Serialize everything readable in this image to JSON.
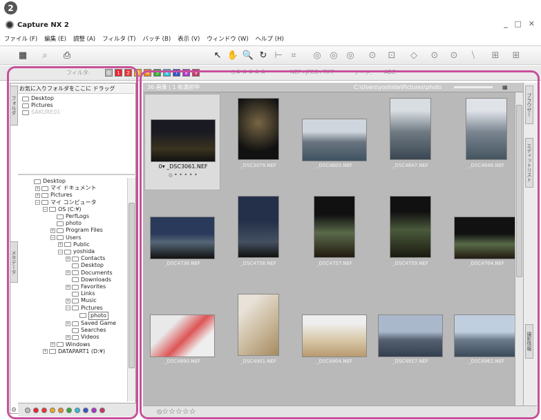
{
  "badge": "2",
  "app": {
    "title": "Capture NX 2",
    "window_controls": "_ □ ✕"
  },
  "menu": [
    "ファイル (F)",
    "編集 (E)",
    "調整 (A)",
    "フィルタ (T)",
    "バッチ (B)",
    "表示 (V)",
    "ウィンドウ (W)",
    "ヘルプ (H)"
  ],
  "toolbar2": {
    "filter_label": "フィルタ:",
    "label_nums": [
      "0",
      "1",
      "2",
      "3",
      "4",
      "5",
      "6",
      "7",
      "8",
      "9"
    ],
    "stars": "⦸★★★★★",
    "filetype": "NEF+JPEG+TIFF",
    "sort": "ソート:",
    "sort_val": "ABC"
  },
  "favorites": {
    "header": "お気に入りフォルダをここに ドラッグ",
    "items": [
      "Desktop",
      "Pictures",
      "SAKURE01"
    ]
  },
  "tree": [
    {
      "label": "Desktop",
      "depth": 0,
      "exp": ""
    },
    {
      "label": "マイ ドキュメント",
      "depth": 1,
      "exp": "+"
    },
    {
      "label": "Pictures",
      "depth": 1,
      "exp": "+"
    },
    {
      "label": "マイ コンピュータ",
      "depth": 1,
      "exp": "−"
    },
    {
      "label": "OS (C:¥)",
      "depth": 2,
      "exp": "−"
    },
    {
      "label": "PerfLogs",
      "depth": 3,
      "exp": ""
    },
    {
      "label": "photo",
      "depth": 3,
      "exp": ""
    },
    {
      "label": "Program Files",
      "depth": 3,
      "exp": "+"
    },
    {
      "label": "Users",
      "depth": 3,
      "exp": "−"
    },
    {
      "label": "Public",
      "depth": 4,
      "exp": "+"
    },
    {
      "label": "yoshida",
      "depth": 4,
      "exp": "−"
    },
    {
      "label": "Contacts",
      "depth": 5,
      "exp": "+"
    },
    {
      "label": "Desktop",
      "depth": 5,
      "exp": ""
    },
    {
      "label": "Documents",
      "depth": 5,
      "exp": "+"
    },
    {
      "label": "Downloads",
      "depth": 5,
      "exp": ""
    },
    {
      "label": "Favorites",
      "depth": 5,
      "exp": "+"
    },
    {
      "label": "Links",
      "depth": 5,
      "exp": ""
    },
    {
      "label": "Music",
      "depth": 5,
      "exp": "+"
    },
    {
      "label": "Pictures",
      "depth": 5,
      "exp": "−"
    },
    {
      "label": "photo",
      "depth": 6,
      "exp": "",
      "selected": true
    },
    {
      "label": "Saved Game",
      "depth": 5,
      "exp": "+"
    },
    {
      "label": "Searches",
      "depth": 5,
      "exp": ""
    },
    {
      "label": "Videos",
      "depth": 5,
      "exp": "+"
    },
    {
      "label": "Windows",
      "depth": 3,
      "exp": "+"
    },
    {
      "label": "DATAPART1 (D:¥)",
      "depth": 2,
      "exp": "+"
    }
  ],
  "side_tabs": {
    "folder": "フォルダ",
    "metadata": "メタデータ",
    "right1": "ブラウザー",
    "right2": "エディットリスト",
    "right3": "撮影情報"
  },
  "grid": {
    "status": "36 画像 | 1 枚選択中",
    "path": "C:\\Users\\yoshida\\Pictures\\photo",
    "items": [
      {
        "name": "_DSC3061.NEF",
        "rating": "0",
        "stars": "⦸ • • • • •",
        "selected": true
      },
      {
        "name": "_DSC3079.NEF"
      },
      {
        "name": "_DSC4603.NEF"
      },
      {
        "name": "_DSC4647.NEF"
      },
      {
        "name": "_DSC4646.NEF"
      },
      {
        "name": "_DSC4736.NEF"
      },
      {
        "name": "_DSC4756.NEF"
      },
      {
        "name": "_DSC4757.NEF"
      },
      {
        "name": "_DSC4759.NEF"
      },
      {
        "name": "_DSC4764.NEF"
      },
      {
        "name": "_DSC4890.NEF"
      },
      {
        "name": "_DSC4901.NEF"
      },
      {
        "name": "_DSC4904.NEF"
      },
      {
        "name": "_DSC4917.NEF"
      },
      {
        "name": "_DSC4962.NEF"
      }
    ]
  },
  "bottom": {
    "stars": "⦸☆☆☆☆☆"
  },
  "highlight_color": "#c8509a"
}
